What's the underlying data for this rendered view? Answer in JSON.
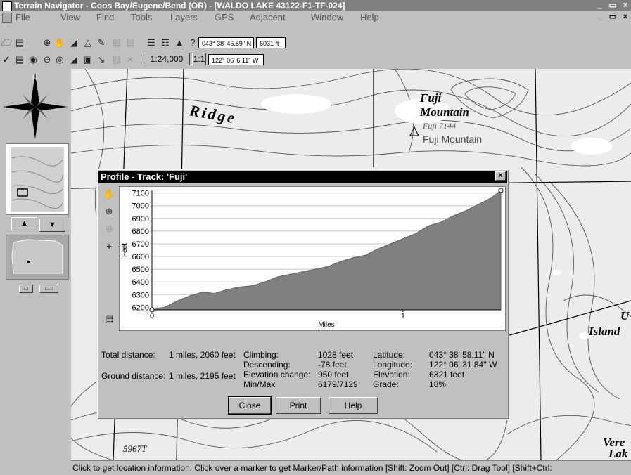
{
  "window": {
    "title": "Terrain Navigator - Coos Bay/Eugene/Bend (OR) - [WALDO LAKE 43122-F1-TF-024]"
  },
  "menu": [
    "File",
    "View",
    "Find",
    "Tools",
    "Layers",
    "GPS",
    "Adjacent",
    "Window",
    "Help"
  ],
  "toolbar": {
    "latitude": "043° 38' 46.59\" N",
    "longitude": "122° 06' 6.11\" W",
    "elevation": "6031 ft",
    "scale": "1:24,000",
    "scale_one": "1:1",
    "help_glyph": "?"
  },
  "map": {
    "labels": {
      "ridge": "Ridge",
      "fuji_title": "Fuji",
      "mountain_title": "Mountain",
      "fuji_elev": "Fuji 7144",
      "fuji_name": "Fuji Mountain",
      "island": "Island",
      "spot_elev": "5967T",
      "edge_u": "U",
      "edge_vere": "Vere",
      "edge_lak": "Lak"
    }
  },
  "profile": {
    "title": "Profile - Track: 'Fuji'",
    "close_glyph": "×",
    "stats": {
      "total_distance_label": "Total distance:",
      "total_distance_value": "1 miles, 2060 feet",
      "ground_distance_label": "Ground distance:",
      "ground_distance_value": "1 miles, 2195 feet",
      "climbing_label": "Climbing:",
      "climbing_value": "1028 feet",
      "descending_label": "Descending:",
      "descending_value": "-78 feet",
      "elev_change_label": "Elevation change:",
      "elev_change_value": "950 feet",
      "minmax_label": "Min/Max",
      "minmax_value": "6179/7129",
      "latitude_label": "Latitude:",
      "latitude_value": "043° 38' 58.11'' N",
      "longitude_label": "Longitude:",
      "longitude_value": "122° 06' 31.84'' W",
      "elevation_label": "Elevation:",
      "elevation_value": "6321 feet",
      "grade_label": "Grade:",
      "grade_value": "18%"
    },
    "buttons": {
      "close": "Close",
      "print": "Print",
      "help": "Help"
    }
  },
  "chart_data": {
    "type": "area",
    "xlabel": "Miles",
    "ylabel": "Feet",
    "xlim": [
      0,
      1.39
    ],
    "ylim": [
      6180,
      7120
    ],
    "xticks": [
      "0",
      "1"
    ],
    "yticks": [
      "6200",
      "6300",
      "6400",
      "6500",
      "6600",
      "6700",
      "6800",
      "6900",
      "7000",
      "7100"
    ],
    "grid": true,
    "x": [
      0,
      0.05,
      0.1,
      0.15,
      0.2,
      0.25,
      0.3,
      0.35,
      0.4,
      0.45,
      0.5,
      0.55,
      0.6,
      0.65,
      0.7,
      0.75,
      0.8,
      0.85,
      0.9,
      0.95,
      1.0,
      1.05,
      1.1,
      1.15,
      1.2,
      1.25,
      1.3,
      1.35,
      1.39
    ],
    "y": [
      6180,
      6200,
      6250,
      6290,
      6320,
      6310,
      6340,
      6360,
      6370,
      6400,
      6440,
      6460,
      6480,
      6500,
      6520,
      6560,
      6590,
      6610,
      6660,
      6700,
      6740,
      6780,
      6840,
      6870,
      6920,
      6960,
      7010,
      7060,
      7120
    ],
    "color": "#808080",
    "points_marked": [
      "start",
      "end"
    ]
  },
  "statusbar": {
    "text": "Click to get location information; Click over a marker to get Marker/Path information [Shift: Zoom Out] [Ctrl: Drag Tool] [Shift+Ctrl:"
  }
}
